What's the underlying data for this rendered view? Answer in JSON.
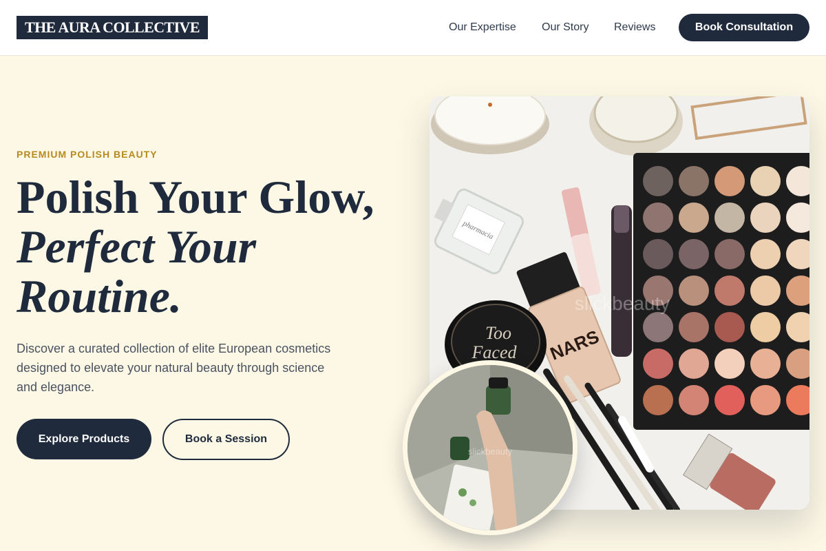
{
  "header": {
    "logo": "THE AURA COLLECTIVE",
    "nav": [
      "Our Expertise",
      "Our Story",
      "Reviews"
    ],
    "cta_label": "Book Consultation"
  },
  "hero": {
    "eyebrow": "PREMIUM POLISH BEAUTY",
    "headline_line1": "Polish Your Glow,",
    "headline_line2": "Perfect Your Routine.",
    "description": "Discover a curated collection of elite European cosmetics designed to elevate your natural beauty through science and elegance.",
    "primary_button": "Explore Products",
    "secondary_button": "Book a Session"
  },
  "image": {
    "watermark": "slickbeauty",
    "circle_watermark": "slickbeauty",
    "too_faced_label_1": "Too",
    "too_faced_label_2": "Faced",
    "nars_label": "NARS",
    "perfume_label": "pharmacia"
  },
  "colors": {
    "navy": "#1f2a3c",
    "cream": "#fdf8e6",
    "gold": "#b58a1e"
  }
}
